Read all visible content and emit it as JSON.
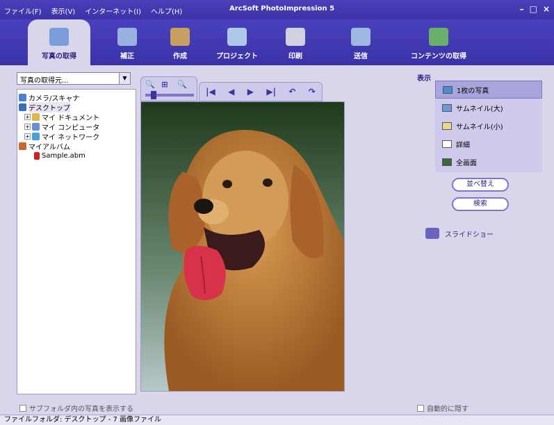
{
  "app": {
    "title": "ArcSoft PhotoImpression 5",
    "menu": [
      "ファイル(F)",
      "表示(V)",
      "インターネット(I)",
      "ヘルプ(H)"
    ]
  },
  "toolbar": {
    "buttons": [
      {
        "label": "写真の取得",
        "icon": "camera-folder-icon",
        "active": true
      },
      {
        "label": "補正",
        "icon": "enhance-icon"
      },
      {
        "label": "作成",
        "icon": "create-icon"
      },
      {
        "label": "プロジェクト",
        "icon": "project-icon"
      },
      {
        "label": "印刷",
        "icon": "printer-icon"
      },
      {
        "label": "送信",
        "icon": "send-icon"
      },
      {
        "label": "コンテンツの取得",
        "icon": "content-icon"
      }
    ]
  },
  "left": {
    "source_combo": "写真の取得元...",
    "tree": [
      {
        "label": "カメラ/スキャナ",
        "indent": 0,
        "color": "#4a7fd4"
      },
      {
        "label": "デスクトップ",
        "indent": 0,
        "color": "#3a6cc0"
      },
      {
        "label": "マイ ドキュメント",
        "indent": 1,
        "color": "#e0b84a",
        "expander": "+"
      },
      {
        "label": "マイ コンピュータ",
        "indent": 1,
        "color": "#6a8fd8",
        "expander": "+"
      },
      {
        "label": "マイ ネットワーク",
        "indent": 1,
        "color": "#4aa0d8",
        "expander": "+"
      },
      {
        "label": "マイアルバム",
        "indent": 0,
        "color": "#c86a2a"
      },
      {
        "label": "Sample.abm",
        "indent": 2,
        "color": "#d02020"
      }
    ],
    "subfolder_checkbox": "サブフォルダ内の写真を表示する"
  },
  "viewer": {
    "zoom_buttons": [
      "🔍",
      "⊞",
      "🔍"
    ],
    "nav_buttons": [
      "|◀",
      "◀",
      "▶",
      "▶|",
      "↶",
      "↷"
    ]
  },
  "right": {
    "section_title": "表示",
    "view_options": [
      {
        "label": "1枚の写真",
        "selected": true
      },
      {
        "label": "サムネイル(大)"
      },
      {
        "label": "サムネイル(小)"
      },
      {
        "label": "詳細"
      },
      {
        "label": "全画面"
      }
    ],
    "sort_button": "並べ替え",
    "search_button": "検索",
    "slideshow": "スライドショー",
    "autohide_checkbox": "自動的に隠す"
  },
  "status": "ファイルフォルダ: デスクトップ - 7 画像ファイル"
}
